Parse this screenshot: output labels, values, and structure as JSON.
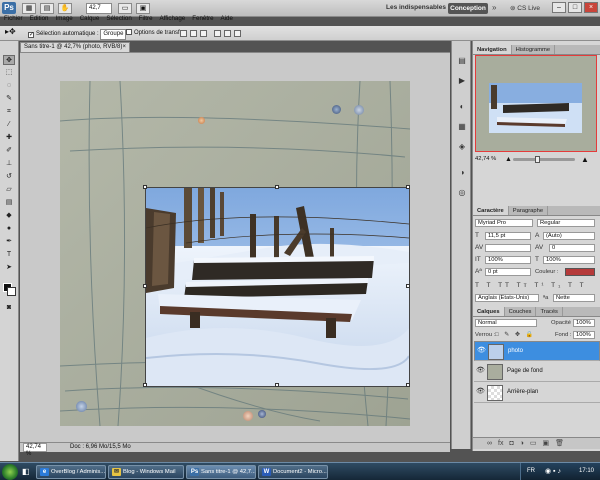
{
  "appbar": {
    "logo": "Ps",
    "zoom": "42,7",
    "workspace_essentials": "Les indispensables",
    "workspace_conception": "Conception",
    "cs_live": "CS Live"
  },
  "menu": [
    "Fichier",
    "Edition",
    "Image",
    "Calque",
    "Sélection",
    "Filtre",
    "Affichage",
    "Fenêtre",
    "Aide"
  ],
  "options": {
    "auto_select": "Sélection automatique :",
    "auto_select_value": "Groupe",
    "transform_options": "Options de transf."
  },
  "document": {
    "tab": "Sans titre-1 @ 42,7% (photo, RVB/8)",
    "close": "×",
    "status_zoom": "42,74 %",
    "status_doc": "Doc : 6,96 Mo/15,5 Mo"
  },
  "panels": {
    "navigation_tabs": [
      "Navigation",
      "Histogramme"
    ],
    "character_tabs": [
      "Caractère",
      "Paragraphe"
    ],
    "layers_tabs": [
      "Calques",
      "Couches",
      "Tracés"
    ]
  },
  "character": {
    "font_family": "Myriad Pro",
    "font_style": "Regular",
    "font_size": "11,5 pt",
    "leading": "(Auto)",
    "tracking": "0",
    "vertical_scale": "100%",
    "horizontal_scale": "100%",
    "baseline": "0 pt",
    "color_label": "Couleur :",
    "color": "#b53a3a",
    "language": "Anglais (Etats-Unis)",
    "antialias": "Nette"
  },
  "layers": {
    "blend_mode": "Normal",
    "opacity_label": "Opacité :",
    "opacity": "100%",
    "lock_label": "Verrou :",
    "fill_label": "Fond :",
    "fill": "100%",
    "items": [
      {
        "name": "photo",
        "selected": true
      },
      {
        "name": "Page de fond",
        "selected": false
      },
      {
        "name": "Arrière-plan",
        "selected": false
      }
    ]
  },
  "taskbar": {
    "items": [
      "OverBlog / Adminis...",
      "Blog - Windows Mail",
      "Sans titre-1 @ 42,7...",
      "Document2 - Micro..."
    ],
    "language": "FR",
    "time": "17:10"
  }
}
